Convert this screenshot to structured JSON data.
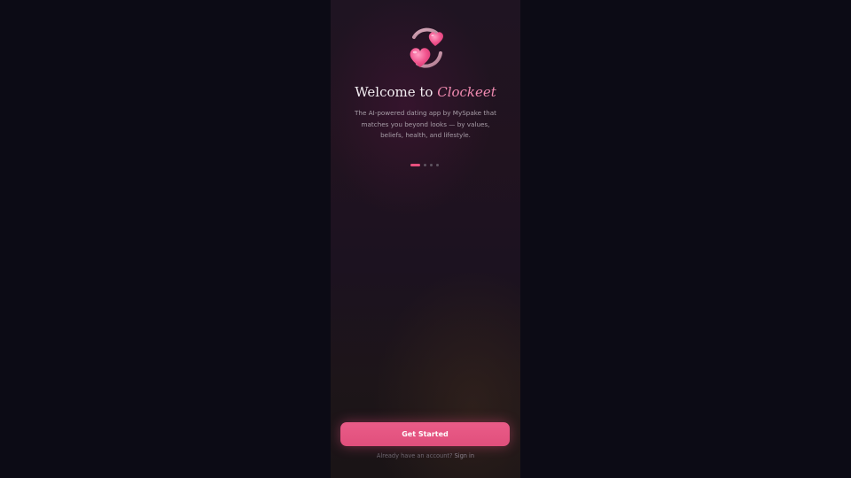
{
  "welcome": {
    "logo_icon": "two-hearts-icon",
    "title_prefix": "Welcome to",
    "brand_name": "Clockeet",
    "description": "The AI-powered dating app by MySpake that matches you beyond looks — by values, beliefs, health, and lifestyle."
  },
  "pagination": {
    "total": 4,
    "active_index": 0
  },
  "actions": {
    "get_started_label": "Get Started",
    "signin_prompt": "Already have an account?",
    "signin_link": "Sign in"
  },
  "colors": {
    "accent": "#e8507e",
    "brand_text": "#f08ab0",
    "background": "#0c0b15"
  }
}
